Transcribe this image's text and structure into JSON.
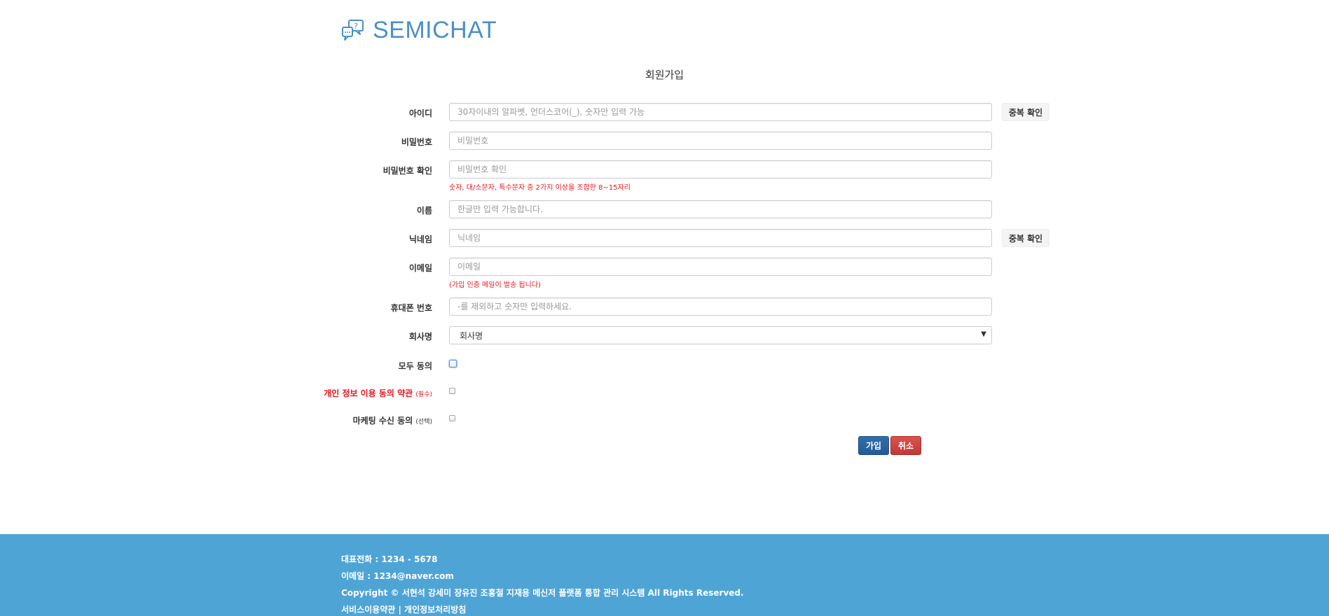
{
  "brand": {
    "name": "SEMICHAT",
    "icon": "chat-bubbles-icon",
    "color": "#4a90c9"
  },
  "page": {
    "title": "회원가입"
  },
  "form": {
    "id": {
      "label": "아이디",
      "placeholder": "30자이내의 알파벳, 언더스코어(_), 숫자만 입력 가능",
      "dup_check": "중복 확인"
    },
    "password": {
      "label": "비밀번호",
      "placeholder": "비밀번호"
    },
    "password_confirm": {
      "label": "비밀번호 확인",
      "placeholder": "비밀번호 확인",
      "hint": "숫자, 대/소문자, 특수문자 중 2가지 이상을 조합한 8~15자리"
    },
    "name": {
      "label": "이름",
      "placeholder": "한글만 입력 가능합니다."
    },
    "nickname": {
      "label": "닉네임",
      "placeholder": "닉네임",
      "dup_check": "중복 확인"
    },
    "email": {
      "label": "이메일",
      "placeholder": "이메일",
      "hint": "(가입 인증 메일이 발송 됩니다)"
    },
    "phone": {
      "label": "휴대폰 번호",
      "placeholder": "-를 제외하고 숫자만 입력하세요."
    },
    "company": {
      "label": "회사명",
      "selected": "회사명"
    },
    "agree_all": {
      "label": "모두 동의"
    },
    "agree_privacy": {
      "label": "개인 정보 이용 동의 약관",
      "tag": "(필수)"
    },
    "agree_marketing": {
      "label": "마케팅 수신 동의",
      "tag": "(선택)"
    },
    "submit_label": "가입",
    "cancel_label": "취소"
  },
  "colors": {
    "required": "#e8141d",
    "footer_bg": "#4fa4d6",
    "submit": "#2f6fad",
    "cancel": "#d9534f"
  },
  "footer": {
    "phone": "대표전화 : 1234 - 5678",
    "email": "이메일 : 1234@naver.com",
    "copyright": "Copyright © 서현석 강세미 장유진 조홍철 지재용 메신저 플랫폼 통합 관리 시스템 All Rights Reserved.",
    "terms": "서비스이용약관",
    "separator": "|",
    "privacy": "개인정보처리방침"
  }
}
